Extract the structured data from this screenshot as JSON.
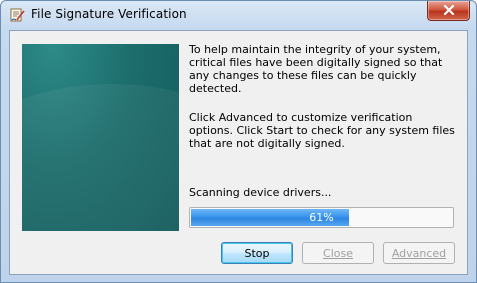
{
  "window": {
    "title": "File Signature Verification",
    "app_icon": "signature-verification-icon",
    "close_icon": "close-icon"
  },
  "content": {
    "intro": "To help maintain the integrity of your system, critical files have been digitally signed so that any changes to these files can be quickly detected.",
    "advanced_info": "Click Advanced to customize verification options. Click Start to check for any system files that are not digitally signed.",
    "status": "Scanning device drivers..."
  },
  "progress": {
    "value": 0.61,
    "label": "61%"
  },
  "buttons": {
    "stop": "Stop",
    "close": "Close",
    "advanced": "Advanced"
  },
  "colors": {
    "progress_fill": "#3896ee",
    "side_panel": "#1c6d6c",
    "close_button": "#c7402a"
  }
}
